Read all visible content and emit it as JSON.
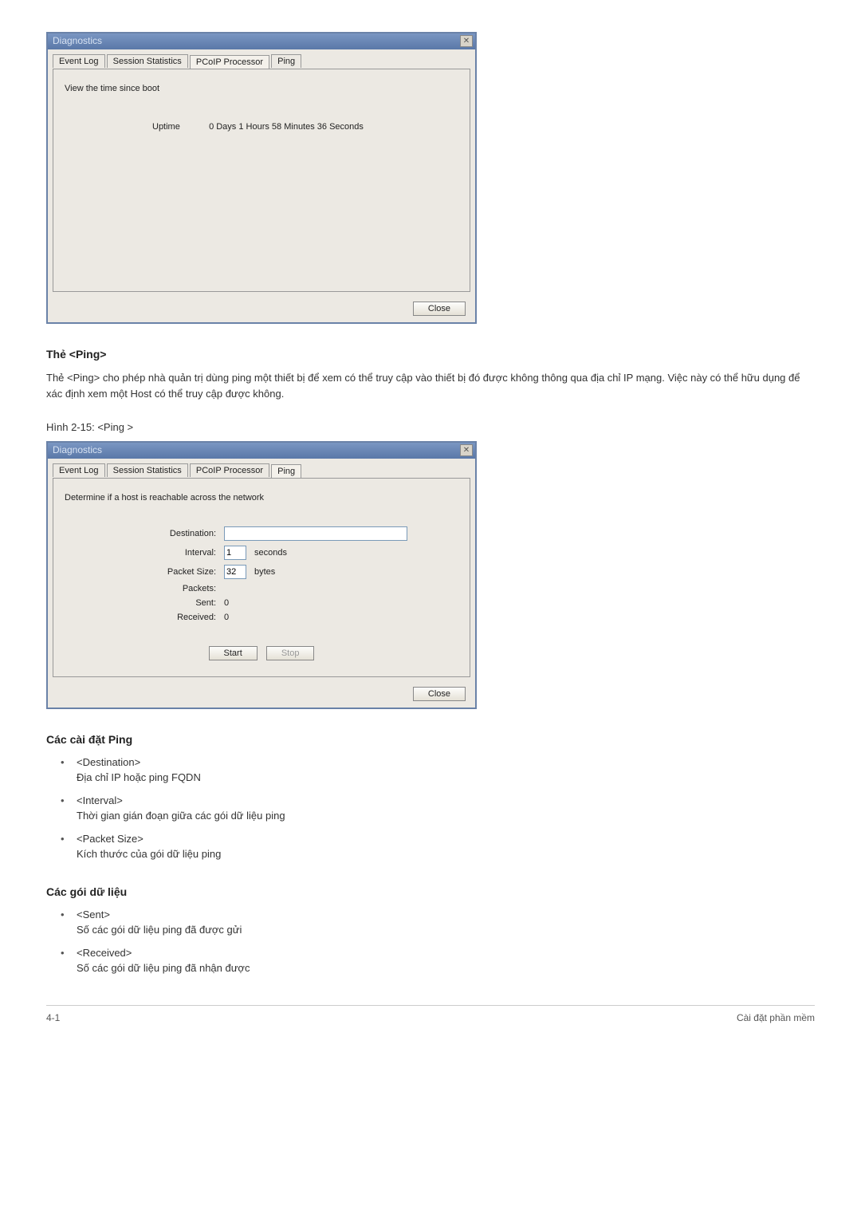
{
  "dialog1": {
    "title": "Diagnostics",
    "tabs": [
      "Event Log",
      "Session Statistics",
      "PCoIP Processor",
      "Ping"
    ],
    "activeTab": 2,
    "desc": "View the time since boot",
    "uptimeLabel": "Uptime",
    "uptimeValue": "0 Days 1 Hours 58 Minutes 36 Seconds",
    "closeBtn": "Close"
  },
  "section1": {
    "heading": "Thẻ <Ping>",
    "body": "Thẻ <Ping> cho phép nhà quản trị dùng ping một thiết bị để xem có thể truy cập vào thiết bị đó được không thông qua địa chỉ IP mạng. Việc này có thể hữu dụng để xác định xem một Host có thể truy cập được không.",
    "figcaption": "Hình 2-15: <Ping >"
  },
  "dialog2": {
    "title": "Diagnostics",
    "tabs": [
      "Event Log",
      "Session Statistics",
      "PCoIP Processor",
      "Ping"
    ],
    "activeTab": 3,
    "desc": "Determine if a host is reachable across the network",
    "labels": {
      "destination": "Destination:",
      "interval": "Interval:",
      "packetSize": "Packet Size:",
      "packets": "Packets:",
      "sent": "Sent:",
      "received": "Received:"
    },
    "values": {
      "destination": "",
      "interval": "1",
      "intervalUnit": "seconds",
      "packetSize": "32",
      "packetSizeUnit": "bytes",
      "sent": "0",
      "received": "0"
    },
    "startBtn": "Start",
    "stopBtn": "Stop",
    "closeBtn": "Close"
  },
  "section2": {
    "heading": "Các cài đặt Ping",
    "items": [
      {
        "term": "<Destination>",
        "def": "Địa chỉ IP hoặc ping FQDN"
      },
      {
        "term": "<Interval>",
        "def": "Thời gian gián đoạn giữa các gói dữ liệu ping"
      },
      {
        "term": "<Packet Size>",
        "def": "Kích thước của gói dữ liệu ping"
      }
    ]
  },
  "section3": {
    "heading": "Các gói dữ liệu",
    "items": [
      {
        "term": "<Sent>",
        "def": "Số các gói dữ liệu ping đã được gửi"
      },
      {
        "term": "<Received>",
        "def": "Số các gói dữ liệu ping đã nhận được"
      }
    ]
  },
  "footer": {
    "left": "4-1",
    "right": "Cài đặt phần mềm"
  }
}
